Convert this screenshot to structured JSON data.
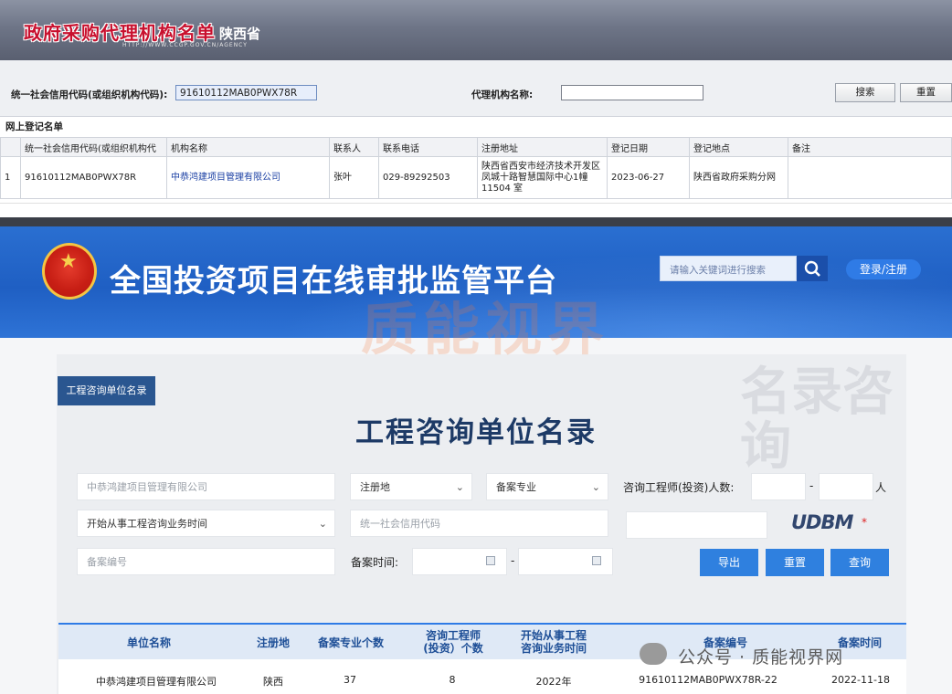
{
  "gp": {
    "title": "政府采购代理机构名单",
    "province": "陕西省",
    "url": "HTTP://WWW.CCGP.GOV.CN/AGENCY",
    "credit_code_label": "统一社会信用代码(或组织机构代码):",
    "credit_code_value": "91610112MAB0PWX78R",
    "agency_name_label": "代理机构名称:",
    "agency_name_value": "",
    "search_button": "搜索",
    "reset_button": "重置",
    "section_title": "网上登记名单",
    "columns": [
      "",
      "统一社会信用代码(或组织机构代",
      "机构名称",
      "联系人",
      "联系电话",
      "注册地址",
      "登记日期",
      "登记地点",
      "备注"
    ],
    "rows": [
      {
        "index": "1",
        "code": "91610112MAB0PWX78R",
        "name": "中恭鸿建项目管理有限公司",
        "contact": "张叶",
        "phone": "029-89292503",
        "address": "陕西省西安市经济技术开发区凤城十路智慧国际中心1幢11504 室",
        "date": "2023-06-27",
        "place": "陕西省政府采购分网",
        "note": ""
      }
    ]
  },
  "tz": {
    "title": "全国投资项目在线审批监管平台",
    "search_placeholder": "请输入关键词进行搜索",
    "login": "登录/注册",
    "tag": "工程咨询单位名录",
    "heading": "工程咨询单位名录",
    "company_field": "中恭鸿建项目管理有限公司",
    "region_select": "注册地",
    "specialty_select": "备案专业",
    "engineers_label": "咨询工程师(投资)人数:",
    "range_separator": "-",
    "person_unit": "人",
    "start_time_select": "开始从事工程咨询业务时间",
    "credit_placeholder": "统一社会信用代码",
    "record_no_placeholder": "备案编号",
    "record_time_label": "备案时间:",
    "captcha": "UDBM",
    "captcha_star": "*",
    "export_button": "导出",
    "reset_button": "重置",
    "query_button": "查询",
    "columns": [
      "单位名称",
      "注册地",
      "备案专业个数",
      "咨询工程师\n(投资）个数",
      "开始从事工程\n咨询业务时间",
      "备案编号",
      "备案时间"
    ],
    "row": {
      "name": "中恭鸿建项目管理有限公司",
      "region": "陕西",
      "specialties": "37",
      "engineers": "8",
      "start_year": "2022年",
      "record_no": "91610112MAB0PWX78R-22",
      "record_time": "2022-11-18"
    }
  },
  "watermarks": {
    "center": "质能视界",
    "side": "名录咨询",
    "wechat": "公众号 · 质能视界网"
  }
}
